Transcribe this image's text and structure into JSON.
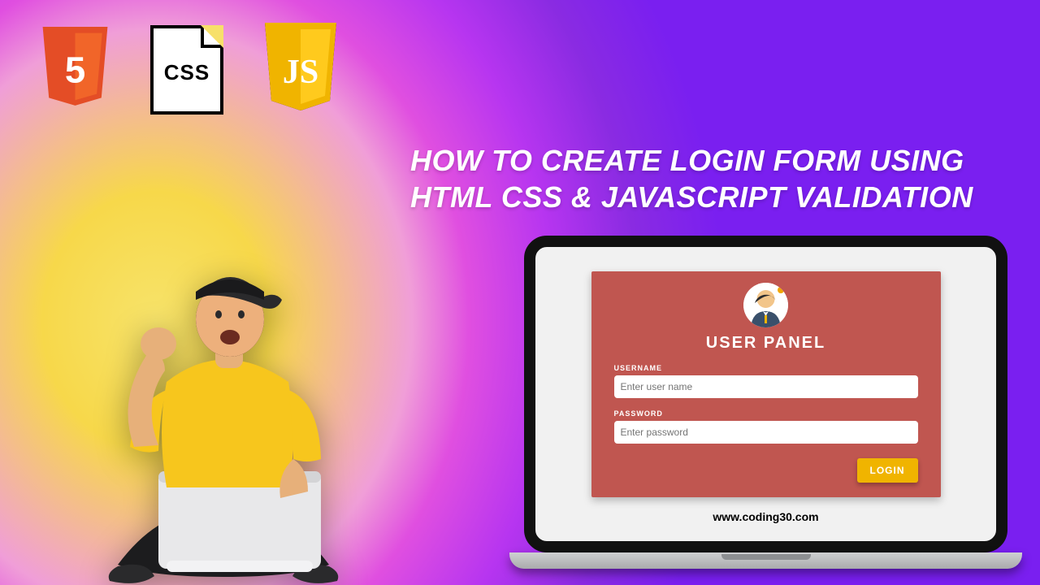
{
  "badges": {
    "html": "5",
    "css": "CSS",
    "js": "JS"
  },
  "heading": {
    "line1": "HOW TO CREATE LOGIN FORM USING",
    "line2": "HTML CSS & JAVASCRIPT VALIDATION"
  },
  "panel": {
    "title": "USER PANEL",
    "username_label": "USERNAME",
    "username_placeholder": "Enter user name",
    "password_label": "PASSWORD",
    "password_placeholder": "Enter password",
    "login_label": "LOGIN"
  },
  "site": "www.coding30.com"
}
